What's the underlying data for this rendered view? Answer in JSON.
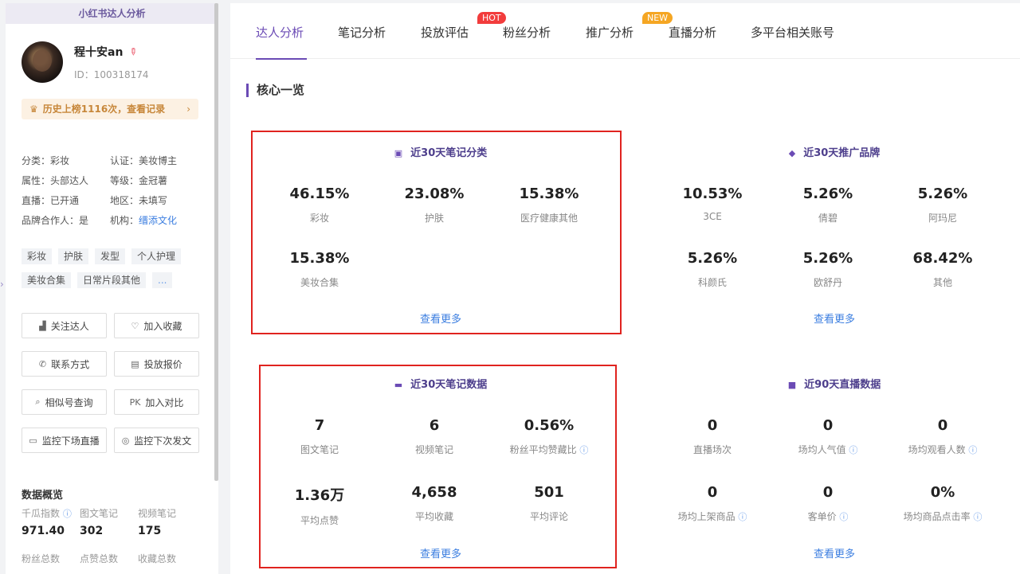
{
  "sidebar": {
    "header": "小红书达人分析",
    "name": "程十安an",
    "id_text": "ID：100318174",
    "ranking": "历史上榜1116次，查看记录",
    "attrs": [
      {
        "label": "分类：彩妆"
      },
      {
        "label": "认证：美妆博主"
      },
      {
        "label": "属性：头部达人"
      },
      {
        "label": "等级：金冠薯"
      },
      {
        "label": "直播：已开通"
      },
      {
        "label": "地区：未填写"
      },
      {
        "label": "品牌合作人：是"
      },
      {
        "prefix": "机构：",
        "link": "缙添文化"
      }
    ],
    "tags": [
      "彩妆",
      "护肤",
      "发型",
      "个人护理",
      "美妆合集",
      "日常片段其他",
      "..."
    ],
    "actions": [
      "关注达人",
      "加入收藏",
      "联系方式",
      "投放报价",
      "相似号查询",
      "加入对比",
      "监控下场直播",
      "监控下次发文"
    ],
    "pk_label": "PK",
    "overview": {
      "title": "数据概览",
      "labels": [
        "千瓜指数",
        "图文笔记",
        "视频笔记"
      ],
      "values": [
        "971.40",
        "302",
        "175"
      ],
      "labels2": [
        "粉丝总数",
        "点赞总数",
        "收藏总数"
      ]
    }
  },
  "tabs": [
    "达人分析",
    "笔记分析",
    "投放评估",
    "粉丝分析",
    "推广分析",
    "直播分析",
    "多平台相关账号"
  ],
  "badges": {
    "hot": "HOT",
    "new": "NEW"
  },
  "section_title": "核心一览",
  "cards": {
    "notes_category": {
      "title": "近30天笔记分类",
      "metrics": [
        {
          "value": "46.15%",
          "label": "彩妆"
        },
        {
          "value": "23.08%",
          "label": "护肤"
        },
        {
          "value": "15.38%",
          "label": "医疗健康其他"
        },
        {
          "value": "15.38%",
          "label": "美妆合集"
        }
      ],
      "more": "查看更多"
    },
    "promo_brands": {
      "title": "近30天推广品牌",
      "metrics": [
        {
          "value": "10.53%",
          "label": "3CE"
        },
        {
          "value": "5.26%",
          "label": "倩碧"
        },
        {
          "value": "5.26%",
          "label": "阿玛尼"
        },
        {
          "value": "5.26%",
          "label": "科颜氏"
        },
        {
          "value": "5.26%",
          "label": "欧舒丹"
        },
        {
          "value": "68.42%",
          "label": "其他"
        }
      ],
      "more": "查看更多"
    },
    "notes_data": {
      "title": "近30天笔记数据",
      "metrics": [
        {
          "value": "7",
          "label": "图文笔记"
        },
        {
          "value": "6",
          "label": "视频笔记"
        },
        {
          "value": "0.56%",
          "label": "粉丝平均赞藏比"
        },
        {
          "value": "1.36万",
          "label": "平均点赞"
        },
        {
          "value": "4,658",
          "label": "平均收藏"
        },
        {
          "value": "501",
          "label": "平均评论"
        }
      ],
      "more": "查看更多"
    },
    "live_data": {
      "title": "近90天直播数据",
      "metrics": [
        {
          "value": "0",
          "label": "直播场次"
        },
        {
          "value": "0",
          "label": "场均人气值"
        },
        {
          "value": "0",
          "label": "场均观看人数"
        },
        {
          "value": "0",
          "label": "场均上架商品"
        },
        {
          "value": "0",
          "label": "客单价"
        },
        {
          "value": "0%",
          "label": "场均商品点击率"
        }
      ],
      "more": "查看更多"
    }
  },
  "colors": {
    "accent": "#6b4bb5",
    "link": "#3b7ee0",
    "highlight_border": "#e0231f",
    "hot": "#f23c3c",
    "new": "#f5a623"
  }
}
